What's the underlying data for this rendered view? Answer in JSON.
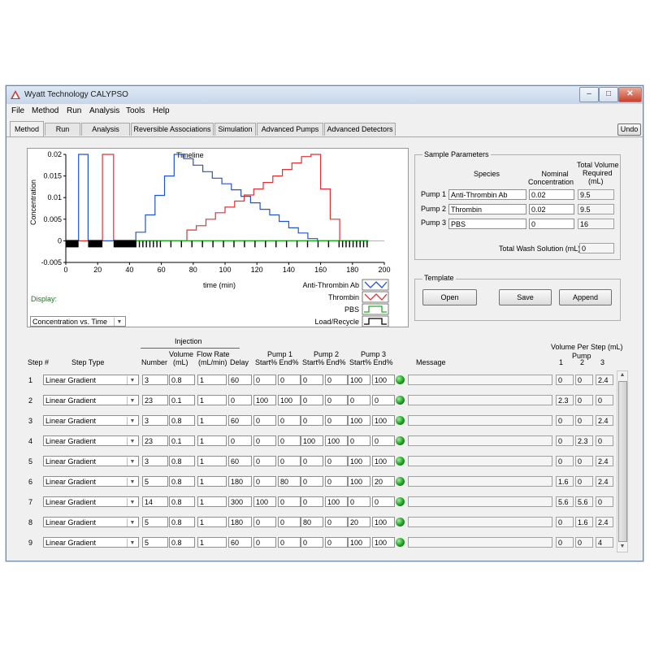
{
  "window": {
    "title": "Wyatt Technology CALYPSO",
    "menu": [
      "File",
      "Method",
      "Run",
      "Analysis",
      "Tools",
      "Help"
    ],
    "tabs": [
      "Method",
      "Run",
      "Analysis",
      "Reversible Associations",
      "Simulation",
      "Advanced Pumps",
      "Advanced Detectors"
    ],
    "active_tab": "Method",
    "undo_label": "Undo",
    "controls": {
      "minimize": "–",
      "maximize": "□",
      "close": "✕"
    }
  },
  "chart": {
    "display_label": "Display:",
    "display_value": "Concentration vs. Time",
    "legend": [
      {
        "name": "Anti-Thrombin Ab",
        "color": "#2255cc"
      },
      {
        "name": "Thrombin",
        "color": "#dd3333"
      },
      {
        "name": "PBS",
        "color": "#22aa22"
      },
      {
        "name": "Load/Recycle",
        "color": "#000000"
      }
    ]
  },
  "chart_data": {
    "type": "line",
    "title": "Timeline",
    "xlabel": "time (min)",
    "ylabel": "Concentration",
    "xlim": [
      0,
      200
    ],
    "ylim": [
      -0.005,
      0.02
    ],
    "xticks": [
      "0",
      "20",
      "40",
      "60",
      "80",
      "100",
      "120",
      "140",
      "160",
      "180",
      "200"
    ],
    "yticks": [
      "0.02",
      "0.015",
      "0.01",
      "0.005",
      "0",
      "-0.005"
    ],
    "series": [
      {
        "name": "Anti-Thrombin Ab",
        "x": [
          0,
          8,
          8,
          14,
          14,
          44,
          44,
          50,
          50,
          56,
          56,
          62,
          62,
          68,
          68,
          74,
          74,
          80,
          80,
          86,
          86,
          92,
          92,
          98,
          98,
          104,
          104,
          110,
          110,
          116,
          116,
          122,
          122,
          128,
          128,
          134,
          134,
          140,
          140,
          146,
          146,
          152,
          152,
          158,
          158,
          164,
          164,
          170,
          170,
          176,
          176,
          182,
          182,
          190
        ],
        "y": [
          0,
          0,
          0.02,
          0.02,
          0,
          0,
          0.002,
          0.002,
          0.006,
          0.006,
          0.0105,
          0.0105,
          0.015,
          0.015,
          0.02,
          0.02,
          0.019,
          0.019,
          0.0175,
          0.0175,
          0.016,
          0.016,
          0.0145,
          0.0145,
          0.0132,
          0.0132,
          0.0118,
          0.0118,
          0.0103,
          0.0103,
          0.0088,
          0.0088,
          0.0073,
          0.0073,
          0.006,
          0.006,
          0.0045,
          0.0045,
          0.003,
          0.003,
          0.0018,
          0.0018,
          0.0005,
          0.0005,
          0,
          0,
          0,
          0,
          0,
          0,
          0,
          0,
          0,
          0
        ]
      },
      {
        "name": "Thrombin",
        "x": [
          0,
          23,
          23,
          30,
          30,
          76,
          76,
          82,
          82,
          88,
          88,
          94,
          94,
          100,
          100,
          106,
          106,
          112,
          112,
          118,
          118,
          124,
          124,
          130,
          130,
          136,
          136,
          142,
          142,
          148,
          148,
          154,
          154,
          160,
          160,
          166,
          166,
          172,
          172,
          180
        ],
        "y": [
          0,
          0,
          0.02,
          0.02,
          0,
          0,
          0.0025,
          0.0025,
          0.0035,
          0.0035,
          0.005,
          0.005,
          0.0065,
          0.0065,
          0.0078,
          0.0078,
          0.0092,
          0.0092,
          0.0106,
          0.0106,
          0.012,
          0.012,
          0.0135,
          0.0135,
          0.015,
          0.015,
          0.0165,
          0.0165,
          0.018,
          0.018,
          0.0195,
          0.0195,
          0.02,
          0.02,
          0.012,
          0.012,
          0.005,
          0.005,
          0,
          0
        ]
      },
      {
        "name": "PBS",
        "x": [
          44,
          190
        ],
        "y": [
          0,
          0
        ]
      }
    ]
  },
  "sample_parameters": {
    "title": "Sample Parameters",
    "col_species": "Species",
    "col_nominal_1": "Nominal",
    "col_nominal_2": "Concentration",
    "col_total_1": "Total Volume",
    "col_total_2": "Required",
    "col_total_3": "(mL)",
    "pumps": [
      {
        "label": "Pump 1",
        "species": "Anti-Thrombin Ab",
        "conc": "0.02",
        "volume": "9.5"
      },
      {
        "label": "Pump 2",
        "species": "Thrombin",
        "conc": "0.02",
        "volume": "9.5"
      },
      {
        "label": "Pump 3",
        "species": "PBS",
        "conc": "0",
        "volume": "16"
      }
    ],
    "wash_label": "Total Wash Solution (mL)",
    "wash_value": "0"
  },
  "template": {
    "title": "Template",
    "open": "Open",
    "save": "Save",
    "append": "Append"
  },
  "steps_table": {
    "injection_label": "Injection",
    "vol_per_step_label": "Volume Per Step (mL)",
    "pump_label": "Pump",
    "headers": {
      "step": "Step #",
      "type": "Step Type",
      "number": "Number",
      "volume_1": "Volume",
      "volume_2": "(mL)",
      "flow_1": "Flow Rate",
      "flow_2": "(mL/min)",
      "delay": "Delay",
      "pump1": "Pump 1",
      "pump2": "Pump 2",
      "pump3": "Pump 3",
      "startend": "Start% End%",
      "message": "Message",
      "p1": "1",
      "p2": "2",
      "p3": "3"
    },
    "rows": [
      {
        "step": "1",
        "type": "Linear Gradient",
        "number": "3",
        "volume": "0.8",
        "flow": "1",
        "delay": "60",
        "p1s": "0",
        "p1e": "0",
        "p2s": "0",
        "p2e": "0",
        "p3s": "100",
        "p3e": "100",
        "message": "",
        "v1": "0",
        "v2": "0",
        "v3": "2.4"
      },
      {
        "step": "2",
        "type": "Linear Gradient",
        "number": "23",
        "volume": "0.1",
        "flow": "1",
        "delay": "0",
        "p1s": "100",
        "p1e": "100",
        "p2s": "0",
        "p2e": "0",
        "p3s": "0",
        "p3e": "0",
        "message": "",
        "v1": "2.3",
        "v2": "0",
        "v3": "0"
      },
      {
        "step": "3",
        "type": "Linear Gradient",
        "number": "3",
        "volume": "0.8",
        "flow": "1",
        "delay": "60",
        "p1s": "0",
        "p1e": "0",
        "p2s": "0",
        "p2e": "0",
        "p3s": "100",
        "p3e": "100",
        "message": "",
        "v1": "0",
        "v2": "0",
        "v3": "2.4"
      },
      {
        "step": "4",
        "type": "Linear Gradient",
        "number": "23",
        "volume": "0.1",
        "flow": "1",
        "delay": "0",
        "p1s": "0",
        "p1e": "0",
        "p2s": "100",
        "p2e": "100",
        "p3s": "0",
        "p3e": "0",
        "message": "",
        "v1": "0",
        "v2": "2.3",
        "v3": "0"
      },
      {
        "step": "5",
        "type": "Linear Gradient",
        "number": "3",
        "volume": "0.8",
        "flow": "1",
        "delay": "60",
        "p1s": "0",
        "p1e": "0",
        "p2s": "0",
        "p2e": "0",
        "p3s": "100",
        "p3e": "100",
        "message": "",
        "v1": "0",
        "v2": "0",
        "v3": "2.4"
      },
      {
        "step": "6",
        "type": "Linear Gradient",
        "number": "5",
        "volume": "0.8",
        "flow": "1",
        "delay": "180",
        "p1s": "0",
        "p1e": "80",
        "p2s": "0",
        "p2e": "0",
        "p3s": "100",
        "p3e": "20",
        "message": "",
        "v1": "1.6",
        "v2": "0",
        "v3": "2.4"
      },
      {
        "step": "7",
        "type": "Linear Gradient",
        "number": "14",
        "volume": "0.8",
        "flow": "1",
        "delay": "300",
        "p1s": "100",
        "p1e": "0",
        "p2s": "0",
        "p2e": "100",
        "p3s": "0",
        "p3e": "0",
        "message": "",
        "v1": "5.6",
        "v2": "5.6",
        "v3": "0"
      },
      {
        "step": "8",
        "type": "Linear Gradient",
        "number": "5",
        "volume": "0.8",
        "flow": "1",
        "delay": "180",
        "p1s": "0",
        "p1e": "0",
        "p2s": "80",
        "p2e": "0",
        "p3s": "20",
        "p3e": "100",
        "message": "",
        "v1": "0",
        "v2": "1.6",
        "v3": "2.4"
      },
      {
        "step": "9",
        "type": "Linear Gradient",
        "number": "5",
        "volume": "0.8",
        "flow": "1",
        "delay": "60",
        "p1s": "0",
        "p1e": "0",
        "p2s": "0",
        "p2e": "0",
        "p3s": "100",
        "p3e": "100",
        "message": "",
        "v1": "0",
        "v2": "0",
        "v3": "4"
      }
    ]
  }
}
